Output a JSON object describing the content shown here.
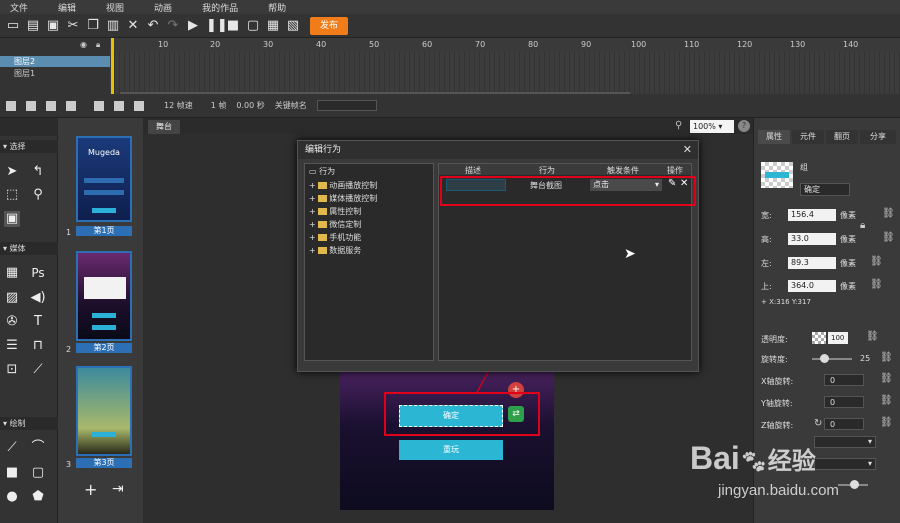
{
  "menu": [
    "文件",
    "编辑",
    "视图",
    "动画",
    "我的作品",
    "帮助"
  ],
  "toolbar": {
    "publish_label": "发布"
  },
  "timeline": {
    "ticks": [
      "10",
      "20",
      "30",
      "40",
      "50",
      "60",
      "70",
      "80",
      "90",
      "100",
      "110",
      "120",
      "130",
      "140"
    ],
    "layers": [
      "图层2",
      "图层1"
    ],
    "status": {
      "fps": "12 帧速",
      "frame": "1 帧",
      "time": "0.00 秒",
      "keyname": "关键帧名"
    }
  },
  "tools": {
    "sections": [
      "选择",
      "媒体",
      "绘制"
    ]
  },
  "pages": [
    {
      "num": "1",
      "label": "第1页",
      "brand": "Mugeda"
    },
    {
      "num": "2",
      "label": "第2页"
    },
    {
      "num": "3",
      "label": "第3页"
    }
  ],
  "stage": {
    "tab": "舞台",
    "zoom": "100%",
    "canvas_buttons": [
      "确定",
      "重玩"
    ]
  },
  "dialog": {
    "title": "编辑行为",
    "tree_root": "行为",
    "tree_items": [
      "动画播放控制",
      "媒体播放控制",
      "属性控制",
      "微信定制",
      "手机功能",
      "数据服务"
    ],
    "columns": [
      "描述",
      "行为",
      "触发条件",
      "操作"
    ],
    "row": {
      "action": "舞台截图",
      "trigger": "点击"
    }
  },
  "rpanel": {
    "tabs": [
      "属性",
      "元件",
      "翻页",
      "分享"
    ],
    "name_value": "确定",
    "name_label": "组",
    "width": {
      "label": "宽:",
      "value": "156.4",
      "unit": "像素"
    },
    "height": {
      "label": "高:",
      "value": "33.0",
      "unit": "像素"
    },
    "left": {
      "label": "左:",
      "value": "89.3",
      "unit": "像素"
    },
    "top": {
      "label": "上:",
      "value": "364.0",
      "unit": "像素"
    },
    "coords": "+ X:316   Y:317",
    "opacity": {
      "label": "透明度:",
      "value": "100"
    },
    "rotation": {
      "label": "旋转度:",
      "value": "25"
    },
    "x_rot": {
      "label": "X轴旋转:",
      "value": "0"
    },
    "y_rot": {
      "label": "Y轴旋转:",
      "value": "0"
    },
    "z_rot": {
      "label": "Z轴旋转:",
      "value": "0"
    }
  },
  "watermark": {
    "brand": "Bai",
    "brand2": "经验",
    "url": "jingyan.baidu.com"
  }
}
